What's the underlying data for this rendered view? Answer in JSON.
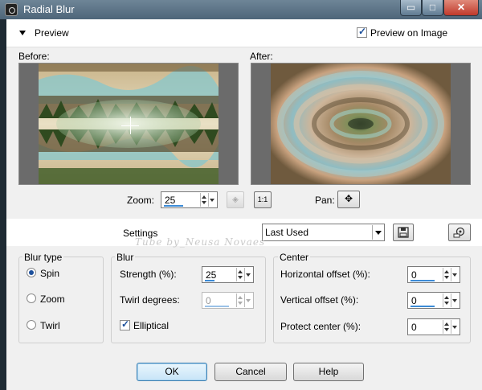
{
  "window": {
    "title": "Radial Blur",
    "minimize_label": "▭",
    "maximize_label": "□",
    "close_label": "✕"
  },
  "preview": {
    "section_label": "Preview",
    "preview_on_image_label": "Preview on Image",
    "preview_on_image_checked": true,
    "before_label": "Before:",
    "after_label": "After:"
  },
  "zoom": {
    "label": "Zoom:",
    "value": "25",
    "actual_size_label": "1:1",
    "fit_icon": "fit-view-icon"
  },
  "pan": {
    "label": "Pan:",
    "icon": "pan-move-icon"
  },
  "settings": {
    "label": "Settings",
    "preset_value": "Last Used",
    "save_icon": "save-preset-icon",
    "manager_icon": "preset-manager-icon"
  },
  "watermark": "Tube by_Neusa Novaes",
  "blur_type": {
    "legend": "Blur type",
    "options": [
      {
        "label": "Spin",
        "selected": true
      },
      {
        "label": "Zoom",
        "selected": false
      },
      {
        "label": "Twirl",
        "selected": false
      }
    ]
  },
  "blur": {
    "legend": "Blur",
    "strength_label": "Strength (%):",
    "strength_value": "25",
    "twirl_label": "Twirl degrees:",
    "twirl_value": "0",
    "elliptical_label": "Elliptical",
    "elliptical_checked": true
  },
  "center": {
    "legend": "Center",
    "hoffset_label": "Horizontal offset (%):",
    "hoffset_value": "0",
    "voffset_label": "Vertical offset (%):",
    "voffset_value": "0",
    "protect_label": "Protect center (%):",
    "protect_value": "0"
  },
  "buttons": {
    "ok": "OK",
    "cancel": "Cancel",
    "help": "Help"
  },
  "colors": {
    "accent": "#3c8bd6",
    "titlebar": "#5b7387",
    "close": "#c0392b"
  }
}
